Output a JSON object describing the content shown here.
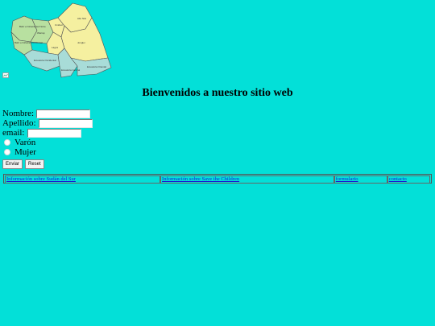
{
  "map": {
    "regions": [
      "Bahr el Ghazal del Norte",
      "Warrap",
      "Unidad",
      "Alto Nilo",
      "Bahr el Ghazal Occidental",
      "Jonglei",
      "Lagos",
      "Ecuatoria Occidental",
      "Ecuatoria Central",
      "Ecuatoria Oriental"
    ]
  },
  "welcome": "Bienvenidos a nuestro sitio web",
  "form": {
    "nombre_label": "Nombre:",
    "apellido_label": "Apellido:",
    "email_label": "email:",
    "varon_label": "Varón",
    "mujer_label": "Mujer",
    "submit_label": "Enviar",
    "reset_label": "Reset"
  },
  "nav": {
    "links": [
      "Información sobre Sudán del Sur",
      "Información sobre Save the Children",
      "formulario",
      "contacto"
    ]
  }
}
